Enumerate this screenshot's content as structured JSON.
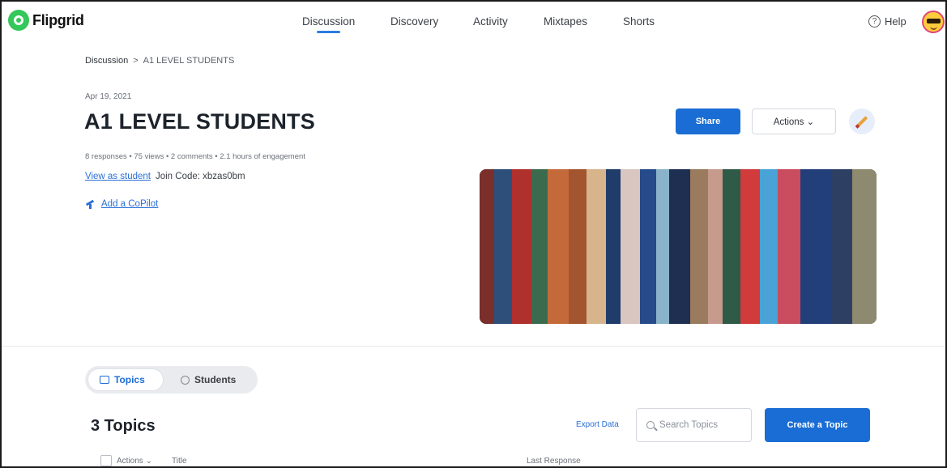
{
  "nav": {
    "logo": "Flipgrid",
    "links": [
      "Discussion",
      "Discovery",
      "Activity",
      "Mixtapes",
      "Shorts"
    ],
    "active": "Discussion",
    "help": "Help"
  },
  "breadcrumb": {
    "root": "Discussion",
    "separator": ">",
    "current": "A1 LEVEL STUDENTS"
  },
  "header": {
    "date": "Apr 19, 2021",
    "title": "A1 LEVEL STUDENTS",
    "stats": "8 responses • 75 views • 2 comments • 2.1 hours of engagement",
    "view_as_student": "View as student",
    "join_code": "Join Code: xbzas0bm",
    "add_copilot": "Add a CoPilot",
    "share_label": "Share",
    "actions_label": "Actions ⌄"
  },
  "tabs": {
    "topics": "Topics",
    "students": "Students"
  },
  "topics": {
    "count_label": "3 Topics",
    "export_label": "Export Data",
    "search_placeholder": "Search Topics",
    "create_label": "Create a Topic",
    "columns": {
      "actions": "Actions ⌄",
      "title": "Title",
      "last_response": "Last Response"
    }
  },
  "colors": {
    "accent": "#1a6dd4",
    "link": "#2a6fd6",
    "logo_green": "#34c759"
  },
  "icons": {
    "help": "question-circle-icon",
    "avatar": "sunglasses-emoji-avatar",
    "edit": "pencil-icon",
    "copilot": "copilot-plane-icon",
    "topics_tab": "grid-icon",
    "students_tab": "user-icon",
    "search": "search-icon"
  }
}
